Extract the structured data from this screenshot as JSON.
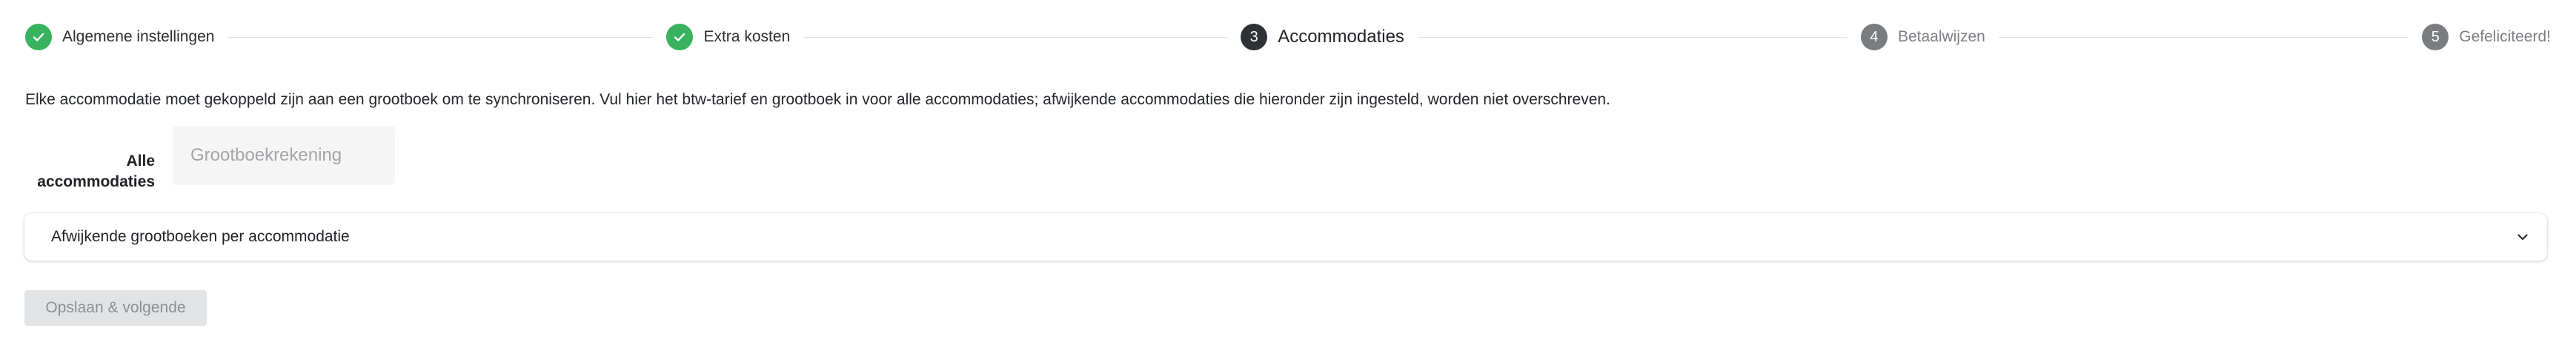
{
  "stepper": {
    "steps": [
      {
        "label": "Algemene instellingen",
        "status": "done",
        "icon": "check-icon"
      },
      {
        "label": "Extra kosten",
        "status": "done",
        "icon": "check-icon"
      },
      {
        "label": "Accommodaties",
        "status": "active",
        "number": "3"
      },
      {
        "label": "Betaalwijzen",
        "status": "todo",
        "number": "4"
      },
      {
        "label": "Gefeliciteerd!",
        "status": "todo",
        "number": "5"
      }
    ],
    "colors": {
      "done": "#38b25e",
      "active": "#2e3135",
      "todo": "#7a7c80"
    }
  },
  "intro": {
    "text": "Elke accommodatie moet gekoppeld zijn aan een grootboek om te synchroniseren. Vul hier het btw-tarief en grootboek in voor alle accommodaties; afwijkende accommodaties die hieronder zijn ingesteld, worden niet overschreven."
  },
  "ledger": {
    "label_line1": "Alle",
    "label_line2": "accommodaties",
    "input_value": "",
    "input_placeholder": "Grootboekrekening"
  },
  "accordion": {
    "title": "Afwijkende grootboeken per accommodatie",
    "icon": "chevron-down-icon",
    "expanded": false
  },
  "actions": {
    "submit_label": "Opslaan & volgende",
    "submit_disabled": true
  }
}
